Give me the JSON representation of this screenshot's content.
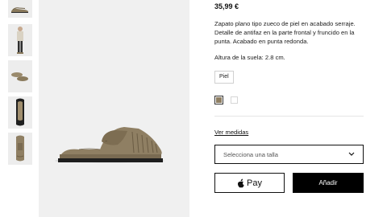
{
  "gallery": {
    "thumbnails": [
      {
        "icon": "shoe-pair-icon"
      },
      {
        "icon": "model-wearing-icon"
      },
      {
        "icon": "shoe-pair-top-icon"
      },
      {
        "icon": "shoe-sole-icon"
      },
      {
        "icon": "shoe-top-view-icon"
      }
    ]
  },
  "product": {
    "price": "35,99 €",
    "description": "Zapato plano tipo zueco de piel en acabado serraje. Detalle de antifaz en la parte frontal y fruncido en la punta. Acabado en punta redonda.",
    "sole_height": "Altura de la suela: 2.8 cm.",
    "material": "Piel",
    "colors": [
      {
        "hex": "#8f7f63",
        "selected": true
      },
      {
        "hex": "#ffffff",
        "selected": false
      }
    ]
  },
  "actions": {
    "size_guide": "Ver medidas",
    "size_select_placeholder": "Selecciona una talla",
    "apple_pay_label": "Pay",
    "add_label": "Añadir"
  },
  "colors": {
    "accent": "#000000",
    "image_bg": "#f0f0f0"
  }
}
